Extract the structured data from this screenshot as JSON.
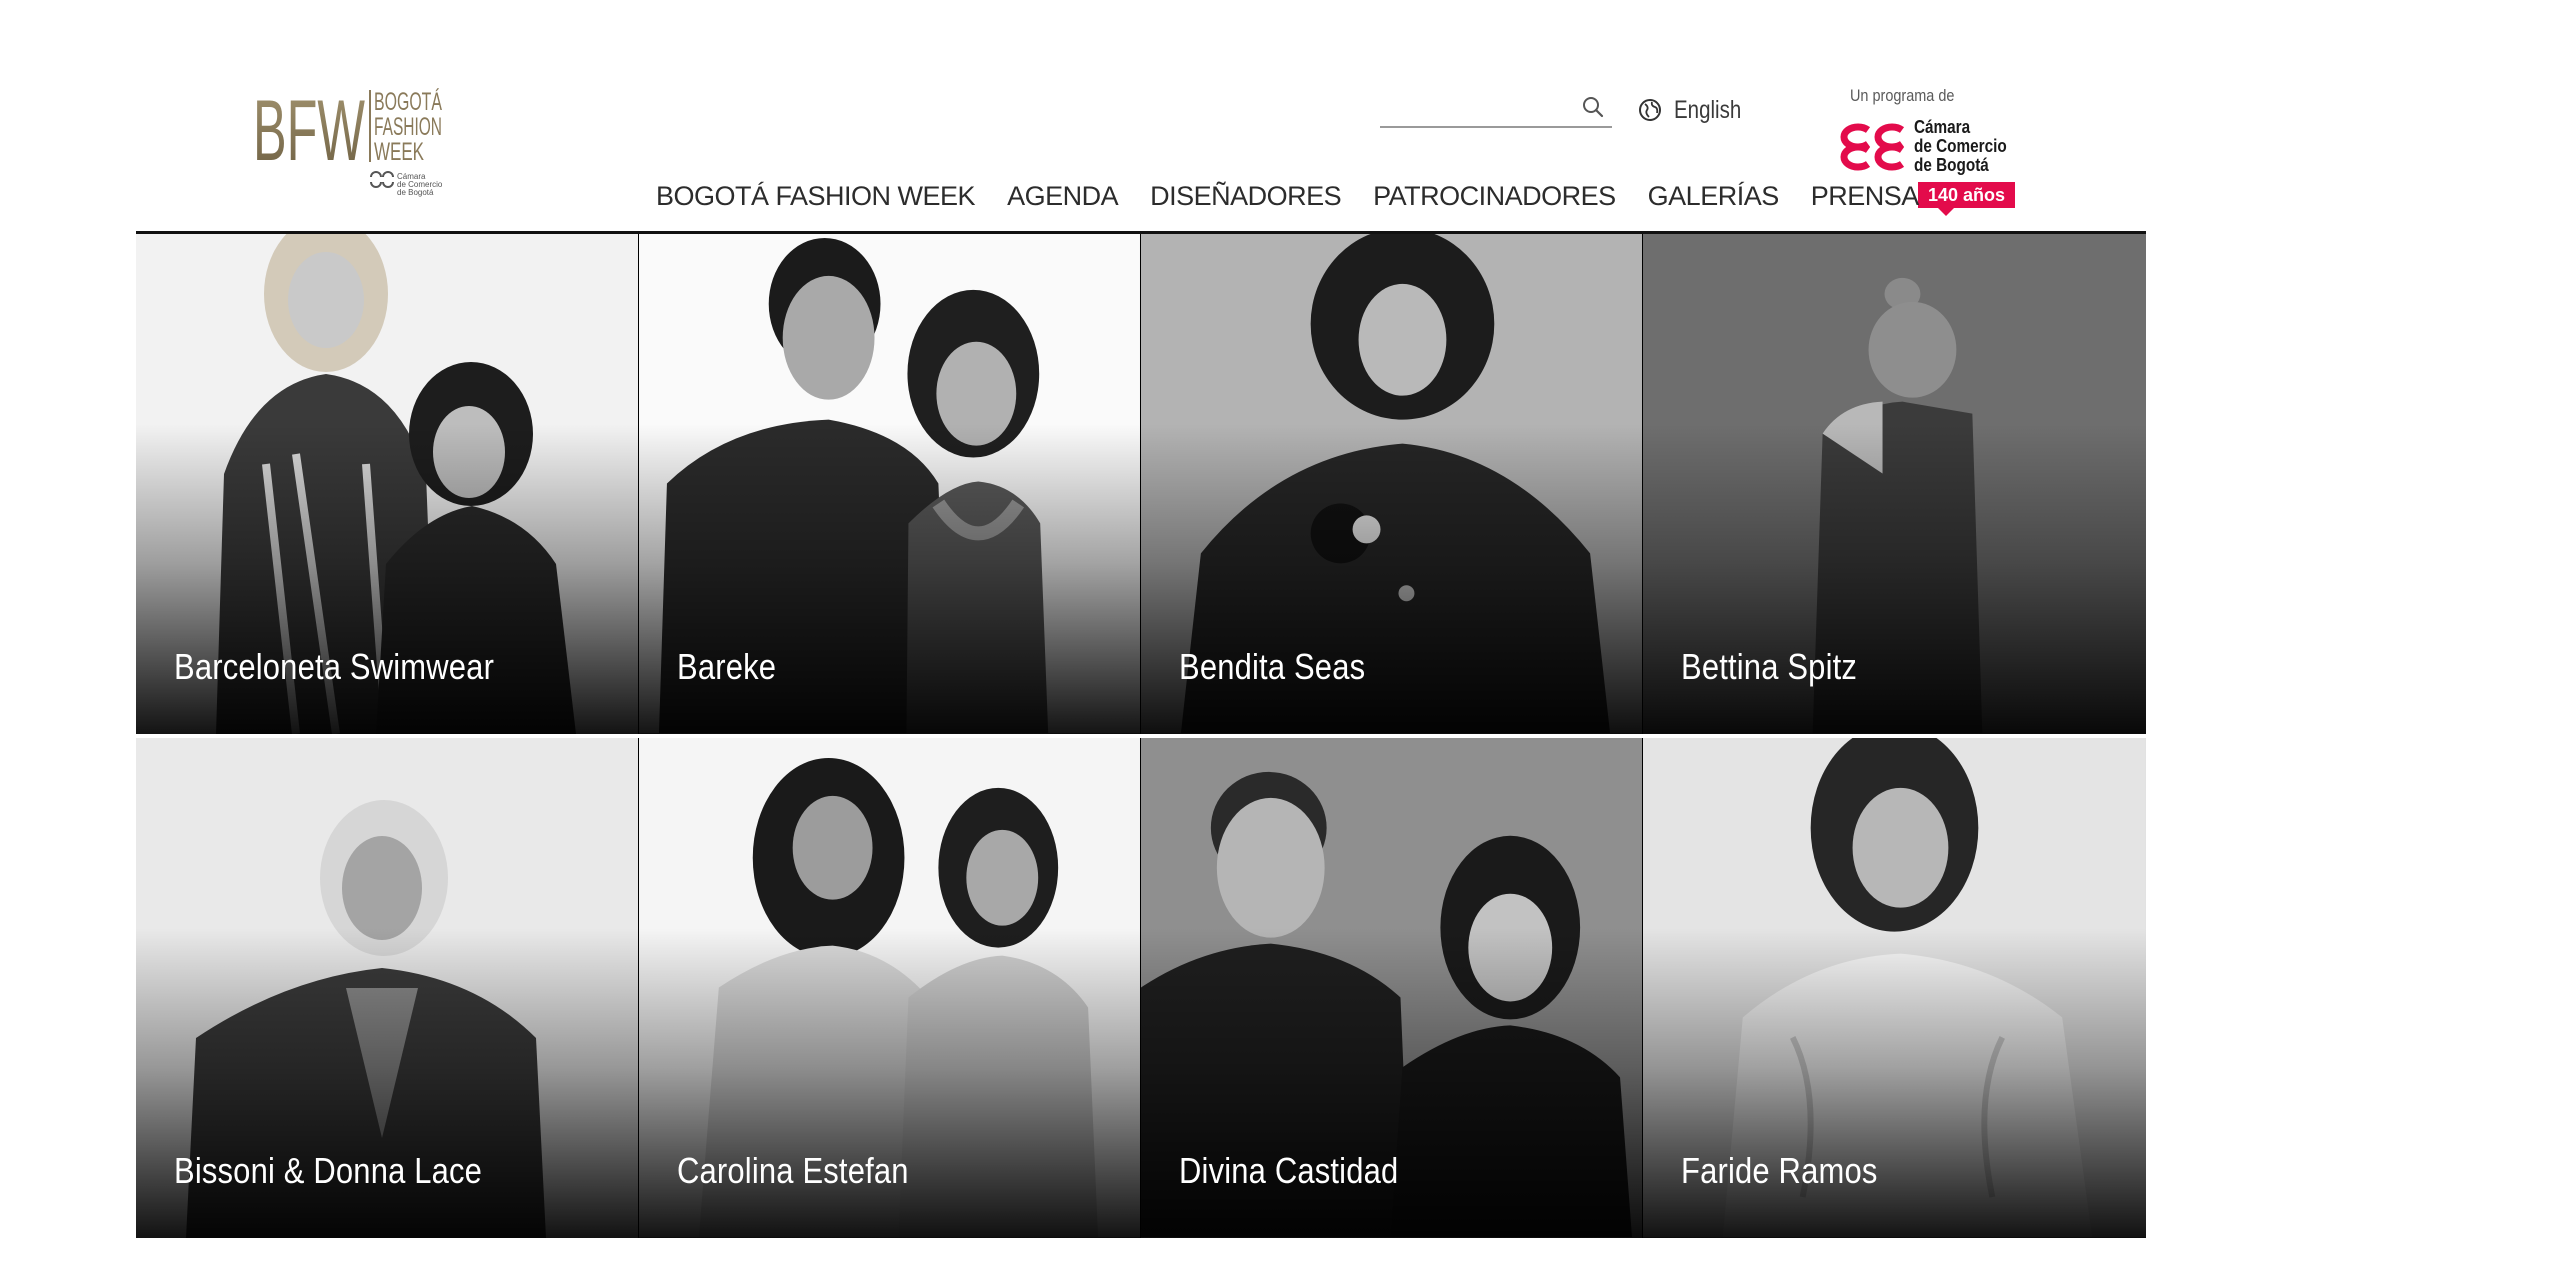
{
  "brand": {
    "logo_letters": "BFW",
    "logo_line1": "BOGOTÁ",
    "logo_line2": "FASHION",
    "logo_line3": "WEEK",
    "logo_small1": "Cámara",
    "logo_small2": "de Comercio",
    "logo_small3": "de Bogotá"
  },
  "search": {
    "value": "",
    "placeholder": "",
    "icon": "search-icon"
  },
  "language": {
    "label": "English",
    "icon": "globe-icon"
  },
  "sponsor": {
    "intro": "Un programa de",
    "name_lines": [
      "Cámara",
      "de Comercio",
      "de Bogotá"
    ],
    "badge": "140 años",
    "accent": "#e30b4b"
  },
  "nav": {
    "items": [
      "BOGOTÁ FASHION WEEK",
      "AGENDA",
      "DISEÑADORES",
      "PATROCINADORES",
      "GALERÍAS",
      "PRENSA"
    ]
  },
  "designers": [
    "Barceloneta Swimwear",
    "Bareke",
    "Bendita Seas",
    "Bettina Spitz",
    "Bissoni & Donna Lace",
    "Carolina Estefan",
    "Divina Castidad",
    "Faride Ramos"
  ],
  "colors": {
    "logo_gold": "#8a7a5a",
    "text": "#2c2c2c",
    "rule": "#111111"
  }
}
